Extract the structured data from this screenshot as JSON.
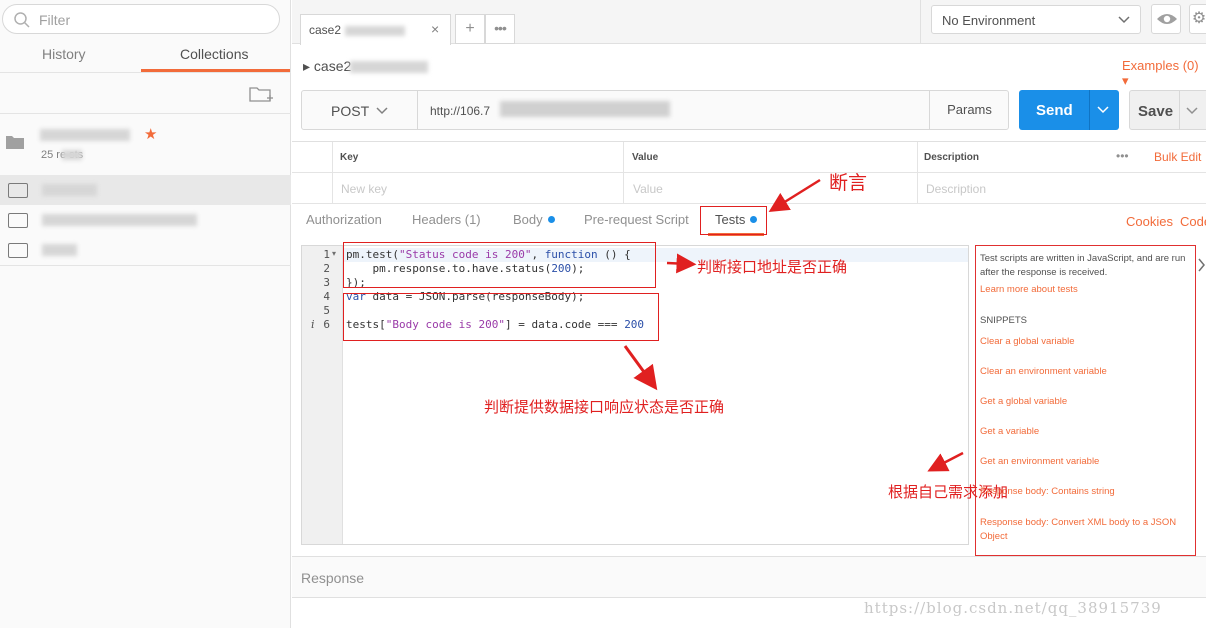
{
  "sidebar": {
    "filter_placeholder": "Filter",
    "tabs": {
      "history": "History",
      "collections": "Collections"
    },
    "collection_sub": "25 re     sts"
  },
  "request_tab": {
    "label": "case2",
    "close": "×"
  },
  "tab_actions": {
    "plus": "+",
    "more": "•••"
  },
  "environment": {
    "selected": "No Environment"
  },
  "breadcrumb": "▸ case2",
  "examples": "Examples (0) ▾",
  "url_bar": {
    "method": "POST",
    "url": "http://106.7",
    "params": "Params"
  },
  "send": "Send",
  "save": "Save",
  "kv_table": {
    "headers": [
      "Key",
      "Value",
      "Description"
    ],
    "placeholders": [
      "New key",
      "Value",
      "Description"
    ],
    "more": "•••",
    "bulk_edit": "Bulk Edit"
  },
  "subtabs": {
    "authorization": "Authorization",
    "headers": "Headers (1)",
    "body": "Body",
    "pre_request": "Pre-request Script",
    "tests": "Tests",
    "cookies": "Cookies",
    "code": "Code"
  },
  "editor": {
    "line_numbers": [
      "1",
      "2",
      "3",
      "4",
      "5",
      "6"
    ],
    "info_marker": "i"
  },
  "snippets_panel": {
    "intro": "Test scripts are written in JavaScript, and are run after the response is received.",
    "learn_more": "Learn more about tests",
    "heading": "SNIPPETS",
    "items": [
      "Clear a global variable",
      "Clear an environment variable",
      "Get a global variable",
      "Get a variable",
      "Get an environment variable",
      "Response body: Contains string",
      "Response body: Convert XML body to a JSON Object"
    ]
  },
  "response_label": "Response",
  "annotations": {
    "assert": "断言",
    "check_url": "判断接口地址是否正确",
    "check_status": "判断提供数据接口响应状态是否正确",
    "add_as_needed": "根据自己需求添加"
  },
  "watermark": "https://blog.csdn.net/qq_38915739",
  "colors": {
    "accent": "#f26b3a",
    "send_blue": "#1a8fe8",
    "annotation_red": "#e02020"
  }
}
